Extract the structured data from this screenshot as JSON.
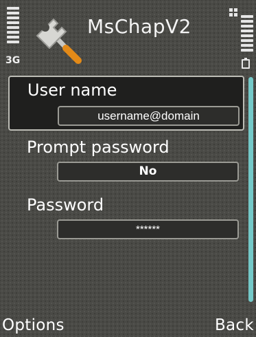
{
  "status_bar": {
    "network_label": "3G",
    "app_title": "MsChapV2",
    "signal_level": 7,
    "battery_level": 7,
    "icons": [
      "signal-strength-icon",
      "wrench-screwdriver-icon",
      "grid-indicator-icon",
      "battery-icon"
    ]
  },
  "settings": [
    {
      "label": "User name",
      "value": "username@domain"
    },
    {
      "label": "Prompt password",
      "value": "No"
    },
    {
      "label": "Password",
      "value": "******"
    }
  ],
  "softkeys": {
    "left": "Options",
    "right": "Back"
  },
  "colors": {
    "background": "#4a4a46",
    "highlight": "#1f1f1e",
    "scrollbar": "#74c9c8"
  }
}
